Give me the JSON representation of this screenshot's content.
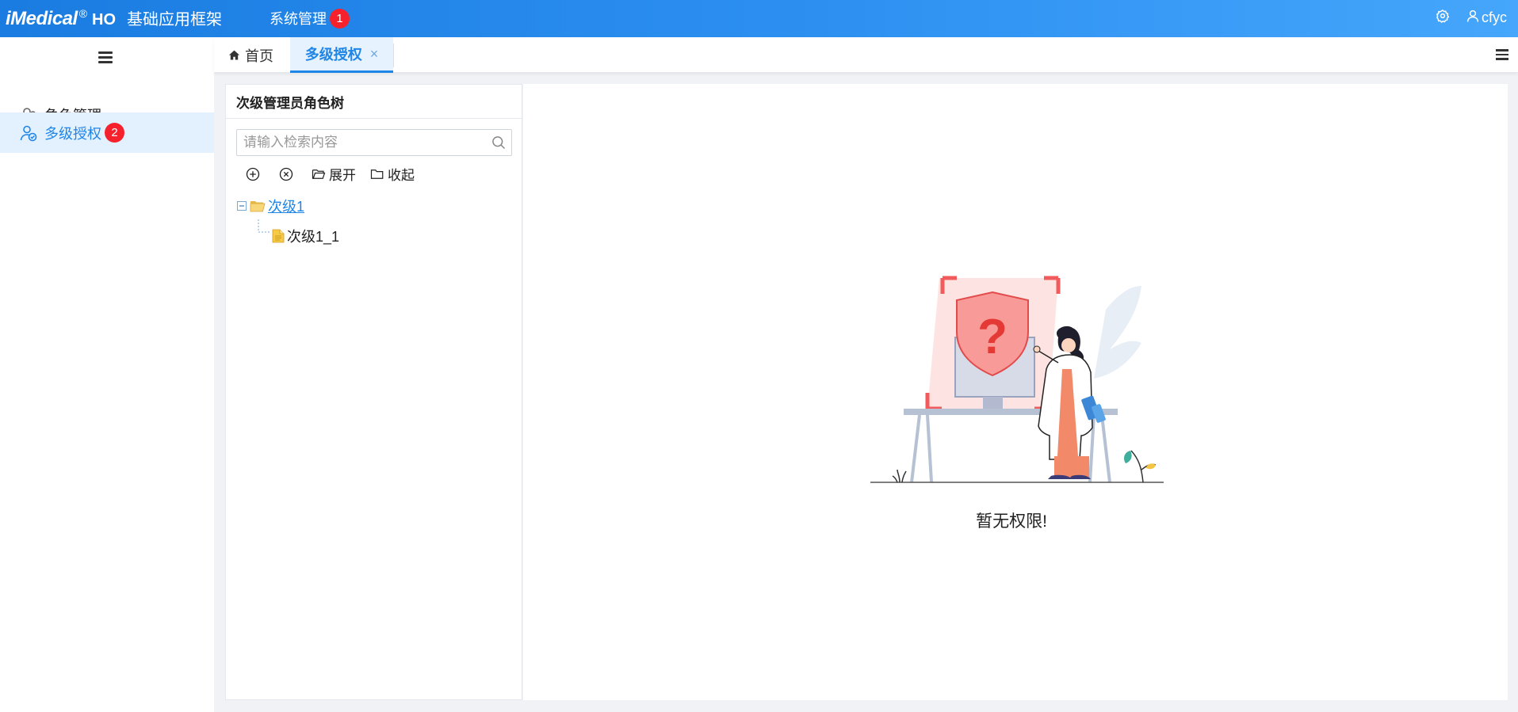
{
  "header": {
    "brand": "iMedical",
    "brand_reg": "®",
    "brand_suffix": "HO",
    "app_title": "基础应用框架",
    "nav_item": "系统管理",
    "nav_badge": "1",
    "username": "cfyc"
  },
  "sidebar": {
    "items": [
      {
        "label": "角色管理",
        "icon": "roles-icon",
        "active": false
      },
      {
        "label": "多级授权",
        "icon": "multi-auth-icon",
        "active": true,
        "badge": "2"
      }
    ]
  },
  "tabs": {
    "home_label": "首页",
    "active_label": "多级授权",
    "close_glyph": "×"
  },
  "tree_panel": {
    "title": "次级管理员角色树",
    "search_placeholder": "请输入检索内容",
    "tools": {
      "expand": "展开",
      "collapse": "收起"
    },
    "nodes": {
      "root": "次级1",
      "child": "次级1_1"
    }
  },
  "content": {
    "empty_message": "暂无权限!"
  },
  "colors": {
    "primary": "#1f86e8",
    "header_start": "#1a7ce0",
    "header_end": "#45a6fb",
    "badge": "#f5222d",
    "active_bg": "#e3f0fd"
  }
}
